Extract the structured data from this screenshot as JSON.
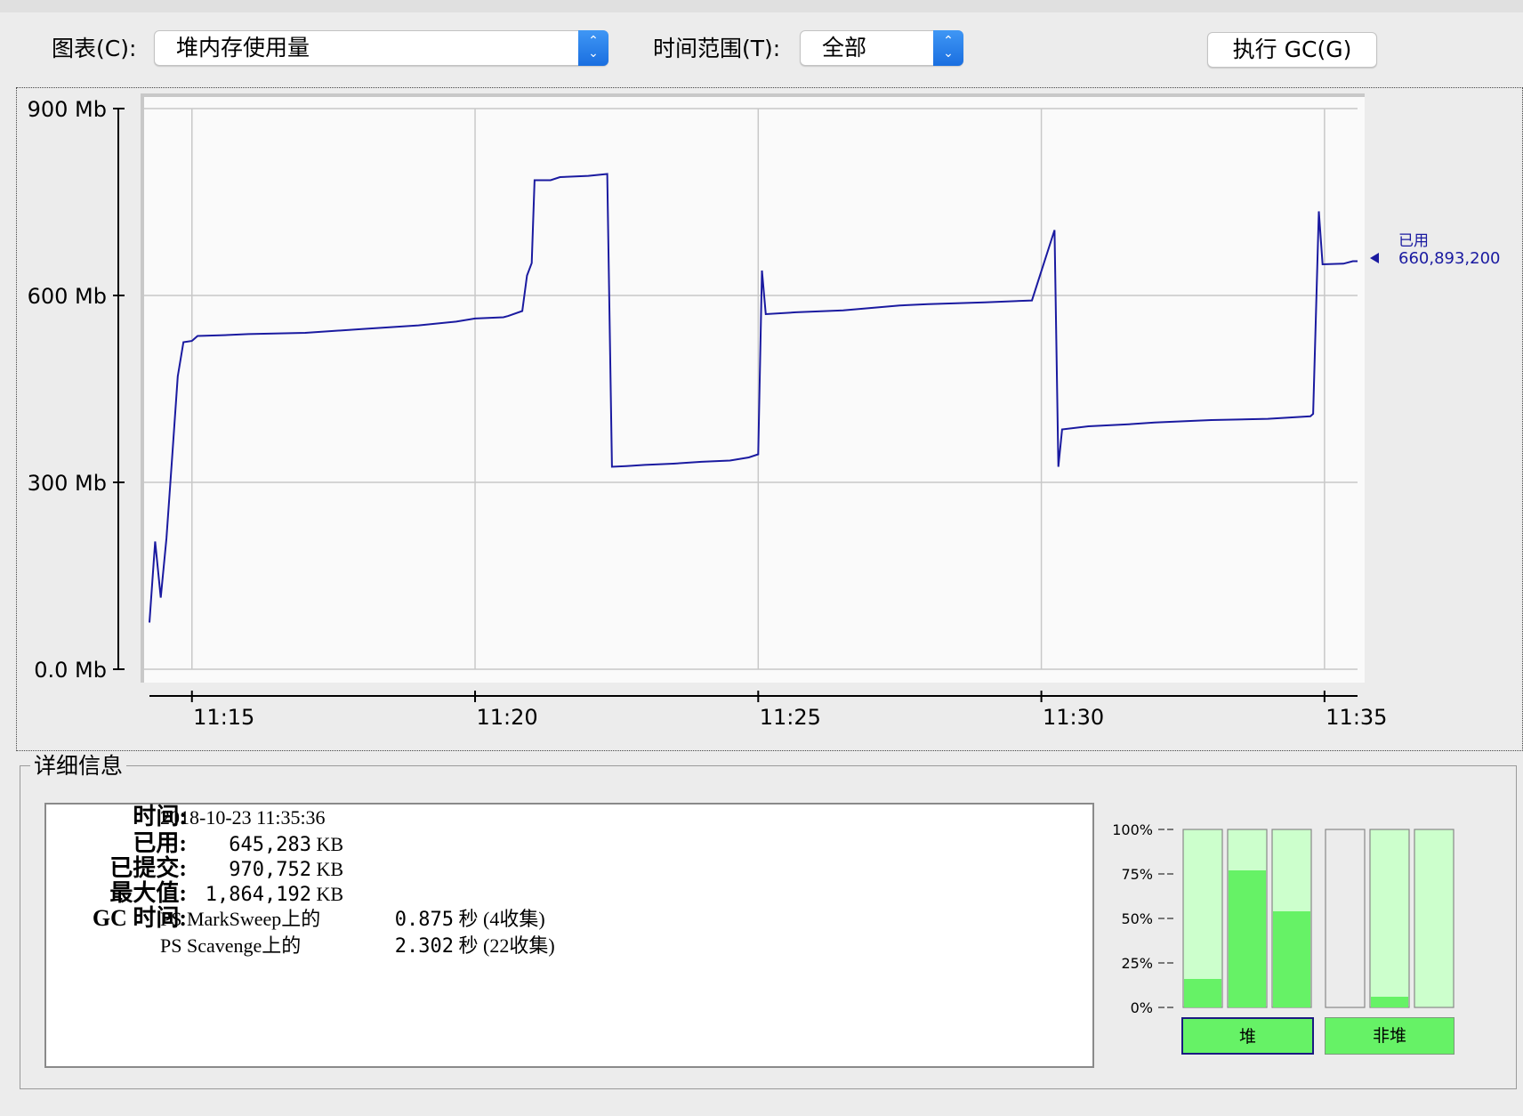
{
  "toolbar": {
    "chart_label": "图表(C):",
    "chart_value": "堆内存使用量",
    "range_label": "时间范围(T):",
    "range_value": "全部",
    "gc_button": "执行 GC(G)"
  },
  "chart_data": {
    "type": "line",
    "title": "",
    "xlabel": "",
    "ylabel": "",
    "ylim": [
      0,
      900
    ],
    "yticks": [
      "900 Mb",
      "600 Mb",
      "300 Mb",
      "0.0 Mb"
    ],
    "xticks": [
      "11:15",
      "11:20",
      "11:25",
      "11:30",
      "11:35"
    ],
    "xlim": [
      "11:14:15",
      "11:35:35"
    ],
    "grid": true,
    "series": [
      {
        "name": "已用",
        "color": "#1a1aa0",
        "current_value": "660,893,200",
        "points": [
          [
            "11:14:15",
            75
          ],
          [
            "11:14:21",
            205
          ],
          [
            "11:14:27",
            115
          ],
          [
            "11:14:33",
            210
          ],
          [
            "11:14:39",
            340
          ],
          [
            "11:14:45",
            470
          ],
          [
            "11:14:51",
            525
          ],
          [
            "11:15:00",
            527
          ],
          [
            "11:15:06",
            535
          ],
          [
            "11:15:30",
            536
          ],
          [
            "11:16:00",
            538
          ],
          [
            "11:17:00",
            540
          ],
          [
            "11:18:00",
            546
          ],
          [
            "11:19:00",
            552
          ],
          [
            "11:19:40",
            558
          ],
          [
            "11:20:00",
            563
          ],
          [
            "11:20:30",
            565
          ],
          [
            "11:20:35",
            567
          ],
          [
            "11:20:50",
            575
          ],
          [
            "11:20:55",
            632
          ],
          [
            "11:21:00",
            652
          ],
          [
            "11:21:03",
            785
          ],
          [
            "11:21:20",
            785
          ],
          [
            "11:21:30",
            790
          ],
          [
            "11:22:00",
            792
          ],
          [
            "11:22:20",
            795
          ],
          [
            "11:22:25",
            325
          ],
          [
            "11:22:40",
            326
          ],
          [
            "11:23:00",
            328
          ],
          [
            "11:23:30",
            330
          ],
          [
            "11:24:00",
            333
          ],
          [
            "11:24:30",
            335
          ],
          [
            "11:24:50",
            340
          ],
          [
            "11:25:00",
            345
          ],
          [
            "11:25:04",
            640
          ],
          [
            "11:25:08",
            570
          ],
          [
            "11:25:40",
            573
          ],
          [
            "11:26:30",
            576
          ],
          [
            "11:27:00",
            580
          ],
          [
            "11:27:30",
            584
          ],
          [
            "11:28:00",
            586
          ],
          [
            "11:29:00",
            589
          ],
          [
            "11:29:50",
            592
          ],
          [
            "11:30:14",
            705
          ],
          [
            "11:30:18",
            325
          ],
          [
            "11:30:22",
            385
          ],
          [
            "11:30:50",
            390
          ],
          [
            "11:31:30",
            393
          ],
          [
            "11:32:00",
            396
          ],
          [
            "11:32:30",
            398
          ],
          [
            "11:33:00",
            400
          ],
          [
            "11:34:00",
            402
          ],
          [
            "11:34:45",
            406
          ],
          [
            "11:34:48",
            410
          ],
          [
            "11:34:54",
            735
          ],
          [
            "11:34:58",
            650
          ],
          [
            "11:35:20",
            651
          ],
          [
            "11:35:30",
            655
          ],
          [
            "11:35:35",
            655
          ]
        ]
      }
    ]
  },
  "details": {
    "legend": "详细信息",
    "time_label": "时间:",
    "time_value": "2018-10-23 11:35:36",
    "used_label": "已用:",
    "used_num": "645,283",
    "used_unit": "KB",
    "committed_label": "已提交:",
    "committed_num": "970,752",
    "committed_unit": "KB",
    "max_label": "最大值:",
    "max_num": "1,864,192",
    "max_unit": "KB",
    "gc_label": "GC 时间:",
    "gc_rows": [
      {
        "name": "PS MarkSweep上的",
        "time": "0.875",
        "unit": "秒",
        "count": "(4收集)"
      },
      {
        "name": "PS Scavenge上的",
        "time": "2.302",
        "unit": "秒",
        "count": "(22收集)"
      }
    ]
  },
  "pools": {
    "ticks": [
      "100%",
      "75%",
      "50%",
      "25%",
      "0%"
    ],
    "heap": [
      0.16,
      0.77,
      0.54
    ],
    "nonheap": [
      0.0,
      0.06,
      0.0
    ],
    "heap_button": "堆",
    "nonheap_button": "非堆",
    "fill_color": "#66f266",
    "empty_color": "#ccffcc"
  }
}
